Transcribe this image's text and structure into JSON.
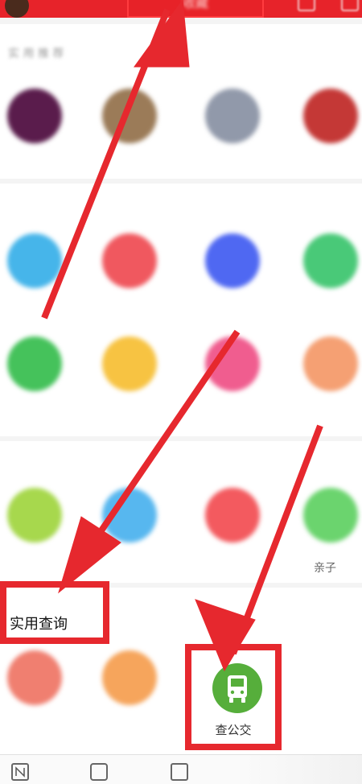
{
  "header": {
    "title": "收藏"
  },
  "sections": {
    "top_row": [
      "",
      "",
      "",
      ""
    ],
    "section2": {
      "title": "",
      "items": [
        "",
        "",
        "",
        "",
        "",
        "",
        "",
        ""
      ]
    },
    "section3": {
      "title": "",
      "items": [
        "",
        "",
        "",
        "亲子"
      ]
    },
    "practical": {
      "title": "实用查询",
      "items": [
        "",
        "",
        "查公交"
      ]
    }
  },
  "colors": {
    "red": "#e7232a",
    "bus_green": "#56ae3b"
  },
  "icons": {
    "bus": "bus-icon",
    "bottom_nav": [
      "n-app-icon",
      "briefcase-icon",
      "building-icon"
    ]
  }
}
